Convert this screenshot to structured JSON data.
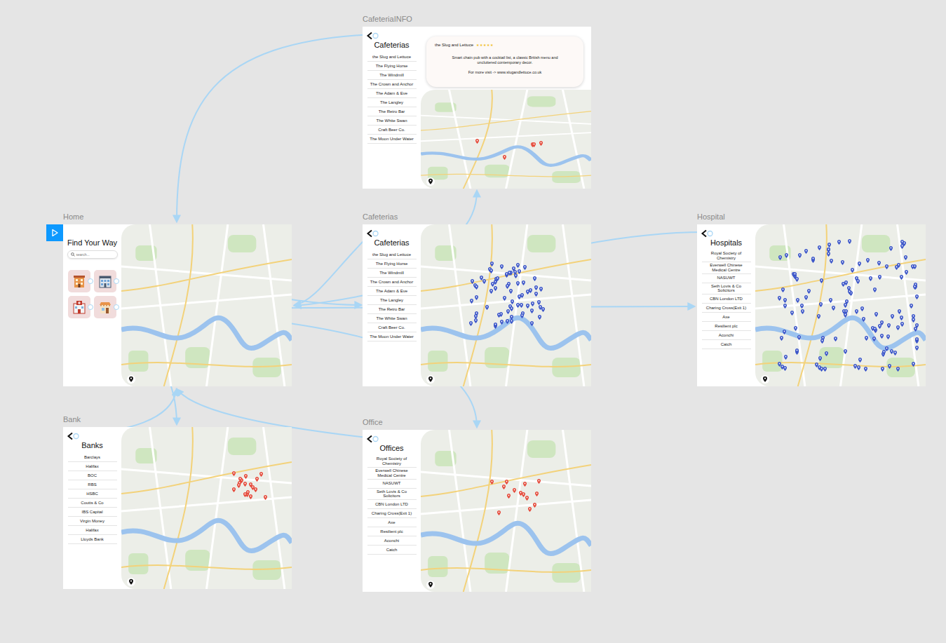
{
  "frames": [
    {
      "name": "CafeteriaINFO",
      "kind": "info",
      "title": "Cafeterias",
      "items": [
        "the Slug and Lettuce",
        "The Flying Horse",
        "The Windmill",
        "The Crown and Anchor",
        "The Adam & Eve",
        "The Langley",
        "The Retro Bar",
        "The White Swan",
        "Craft Beer Co.",
        "The Moon Under Water"
      ],
      "card": {
        "name": "the Slug and Lettuce",
        "stars": 5,
        "star_glyph": "★",
        "description": "Smart chain pub with a cocktail list, a classic British menu and uncluttered contemporary decor.",
        "link": "For more visit -> www.slugandlettuce.co.uk"
      },
      "map": {
        "pin_color": "#e5493a"
      }
    },
    {
      "name": "Home",
      "kind": "home",
      "title": "Find Your Way",
      "search": {
        "placeholder": "search..."
      },
      "map": {}
    },
    {
      "name": "Cafeterias",
      "kind": "list",
      "title": "Cafeterias",
      "items": [
        "the Slug and Lettuce",
        "The Flying Horse",
        "The Windmill",
        "The Crown and Anchor",
        "The Adam & Eve",
        "The Langley",
        "The Retro Bar",
        "The White Swan",
        "Craft Beer Co.",
        "The Moon Under Water"
      ],
      "map": {
        "pin_color": "#3b55c9"
      }
    },
    {
      "name": "Hospital",
      "kind": "list",
      "title": "Hospitals",
      "items": [
        "Royal Society of Chemistry",
        "Everwell Chinese Medical Centre",
        "NASUWT",
        "Seth Lovis & Co Solicitors",
        "CBN London LTD",
        "Charing Cross(Exit 1)",
        "Axe",
        "Resilient plc",
        "Aconchi",
        "Catch"
      ],
      "map": {
        "pin_color": "#3b55c9"
      }
    },
    {
      "name": "Bank",
      "kind": "list",
      "title": "Banks",
      "items": [
        "Barclays",
        "Halifax",
        "BOC",
        "RBS",
        "HSBC",
        "Coutts & Co",
        "IBS Capital",
        "Virgin Money",
        "Halifax",
        "Lloyds Bank"
      ],
      "map": {
        "pin_color": "#e5493a"
      }
    },
    {
      "name": "Office",
      "kind": "list",
      "title": "Offices",
      "items": [
        "Royal Society of Chemistry",
        "Everwell Chinese Medical Centre",
        "NASUWT",
        "Seth Lovis & Co Solicitors",
        "CBN London LTD",
        "Charing Cross(Exit 1)",
        "Axe",
        "Resilient plc",
        "Aconchi",
        "Catch"
      ],
      "map": {
        "pin_color": "#e5493a"
      }
    }
  ],
  "connections": [
    {
      "from": "CafeteriaINFO",
      "to": "Home"
    },
    {
      "from": "Home",
      "to": "Cafeterias"
    },
    {
      "from": "Home",
      "to": "Hospital"
    },
    {
      "from": "Home",
      "to": "Bank"
    },
    {
      "from": "Home",
      "to": "Office"
    },
    {
      "from": "Cafeterias",
      "to": "CafeteriaINFO"
    },
    {
      "from": "Cafeterias",
      "to": "Home"
    },
    {
      "from": "Hospital",
      "to": "Home"
    },
    {
      "from": "Bank",
      "to": "Home"
    },
    {
      "from": "Office",
      "to": "Home"
    }
  ]
}
